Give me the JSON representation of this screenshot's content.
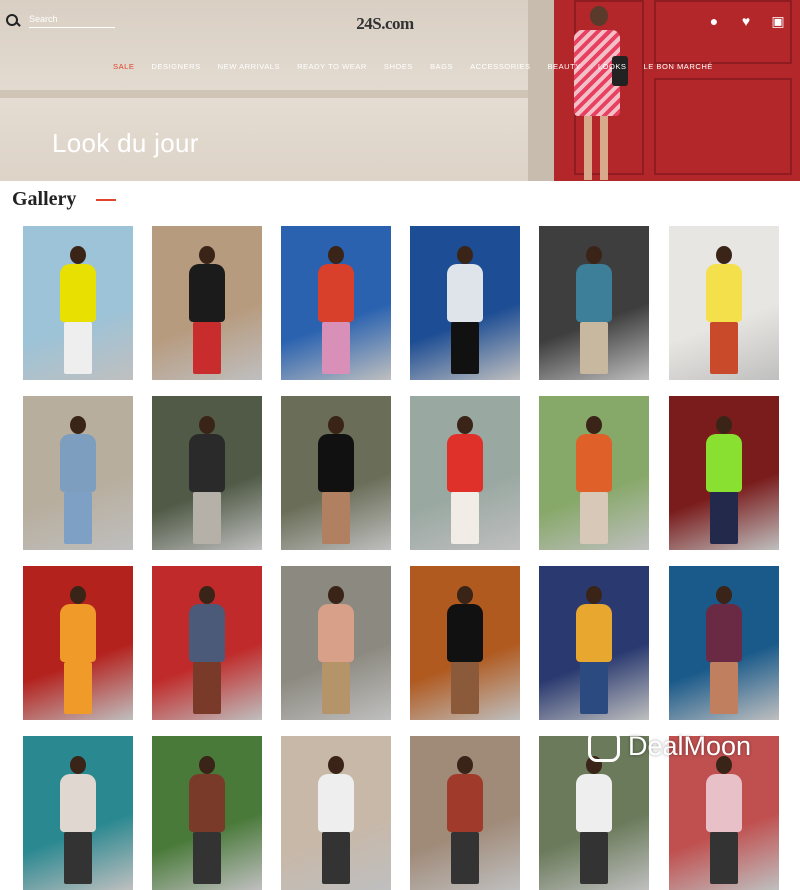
{
  "header": {
    "search_placeholder": "Search",
    "logo": "24S.com",
    "nav": [
      "SALE",
      "DESIGNERS",
      "NEW ARRIVALS",
      "READY TO WEAR",
      "SHOES",
      "BAGS",
      "ACCESSORIES",
      "BEAUTY",
      "LOOKS",
      "LE BON MARCHÉ"
    ],
    "icons": [
      "user-icon",
      "heart-icon",
      "bag-icon"
    ]
  },
  "hero": {
    "title": "Look du jour"
  },
  "gallery": {
    "heading": "Gallery",
    "tiles": [
      {
        "bg": "#9cc3d8",
        "top": "#e8e000",
        "bottom": "#eee"
      },
      {
        "bg": "#b79b7f",
        "top": "#1b1b1b",
        "bottom": "#c92c2c"
      },
      {
        "bg": "#2a62b0",
        "top": "#d8402b",
        "bottom": "#d890b8"
      },
      {
        "bg": "#1d4d94",
        "top": "#dfe4ea",
        "bottom": "#111"
      },
      {
        "bg": "#3e3e3e",
        "top": "#3d7e98",
        "bottom": "#c9b8a0"
      },
      {
        "bg": "#e8e6e2",
        "top": "#f4e04a",
        "bottom": "#c84a2a"
      },
      {
        "bg": "#b8ae9e",
        "top": "#7e9ec0",
        "bottom": "#7ea0c4"
      },
      {
        "bg": "#505a46",
        "top": "#2a2a2a",
        "bottom": "#b5b0a8"
      },
      {
        "bg": "#6a6e58",
        "top": "#111",
        "bottom": "#b08060"
      },
      {
        "bg": "#9aa8a2",
        "top": "#e0302a",
        "bottom": "#f1ede6"
      },
      {
        "bg": "#86a868",
        "top": "#e0602a",
        "bottom": "#d8c8b8"
      },
      {
        "bg": "#7a1c1c",
        "top": "#8ae030",
        "bottom": "#23294a"
      },
      {
        "bg": "#b4221e",
        "top": "#f09a2a",
        "bottom": "#f09a2a"
      },
      {
        "bg": "#c02a2a",
        "top": "#4a5a78",
        "bottom": "#7a3a2a"
      },
      {
        "bg": "#8c8a80",
        "top": "#d8a088",
        "bottom": "#b6946a"
      },
      {
        "bg": "#b05a20",
        "top": "#111",
        "bottom": "#8a5a3a"
      },
      {
        "bg": "#2a3a70",
        "top": "#e8a830",
        "bottom": "#2a4a80"
      },
      {
        "bg": "#1a5a8a",
        "top": "#6a2a44",
        "bottom": "#c08060"
      },
      {
        "bg": "#2a8890",
        "top": "#e0d8d0",
        "bottom": "#333"
      },
      {
        "bg": "#4a7a3a",
        "top": "#7a3a2a",
        "bottom": "#333"
      },
      {
        "bg": "#c8b8a8",
        "top": "#eee",
        "bottom": "#333"
      },
      {
        "bg": "#a08a78",
        "top": "#a03a2a",
        "bottom": "#333"
      },
      {
        "bg": "#6a7a5a",
        "top": "#eee",
        "bottom": "#333"
      },
      {
        "bg": "#c05050",
        "top": "#e8c0c8",
        "bottom": "#333"
      }
    ]
  },
  "watermark": {
    "text": "DealMoon"
  }
}
